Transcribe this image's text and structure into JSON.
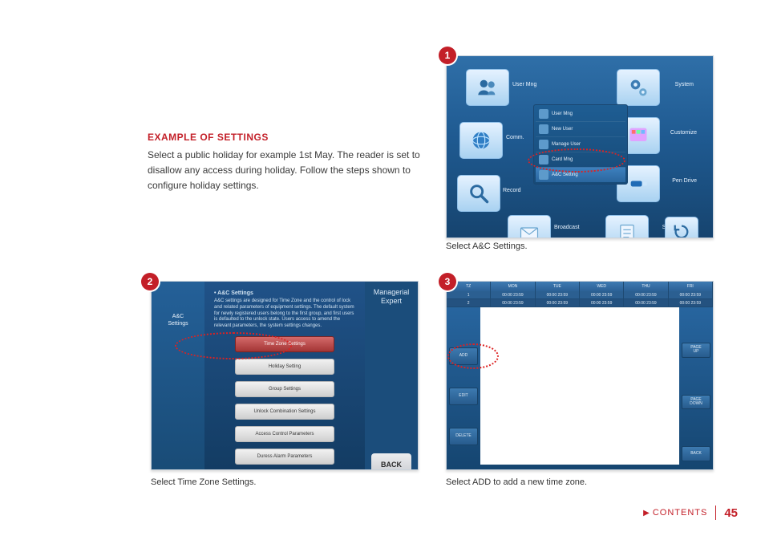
{
  "intro": {
    "heading": "EXAMPLE OF SETTINGS",
    "body": "Select a public holiday for example 1st May. The reader is set to disallow any access during holiday. Follow the steps shown to configure holiday settings."
  },
  "badges": {
    "n1": "1",
    "n2": "2",
    "n3": "3"
  },
  "captions": {
    "c1": "Select A&C Settings.",
    "c2": "Select Time Zone Settings.",
    "c3": "Select ADD to add a new time zone."
  },
  "footer": {
    "contents": "CONTENTS",
    "page": "45"
  },
  "screen1": {
    "tiles": {
      "user": "User Mng",
      "system": "System",
      "comm": "Comm.",
      "customize": "Customize",
      "record": "Record",
      "pdrive": "Pen Drive",
      "broadcast": "Broadcast",
      "sysinfo": "Sys Info"
    },
    "menu": [
      "User Mng",
      "New User",
      "Manage User",
      "Card Mng",
      "A&C Setting"
    ]
  },
  "screen2": {
    "sidebar_title": "A&C\nSettings",
    "right_title": "Managerial\nExpert",
    "back": "BACK",
    "desc_title": "• A&C Settings",
    "desc_body": "A&C settings are designed for Time Zone and the control of lock and related parameters of equipment settings. The default system for newly registered users belong to the first group, and first users is defaulted to the unlock state. Users access to amend the relevant parameters, the system settings changes.",
    "buttons": [
      "Time Zone Settings",
      "Holiday Setting",
      "Group Settings",
      "Unlock Combination Settings",
      "Access Control Parameters",
      "Duress Alarm Parameters"
    ]
  },
  "screen3": {
    "header": [
      "TZ",
      "MON",
      "TUE",
      "WED",
      "THU",
      "FRI"
    ],
    "row1": [
      "1",
      "00:00 23:59",
      "00:00 23:59",
      "00:00 23:59",
      "00:00 23:59",
      "00:00 23:59"
    ],
    "row2": [
      "2",
      "00:00 23:59",
      "00:00 23:59",
      "00:00 23:59",
      "00:00 23:59",
      "00:00 23:59"
    ],
    "left_buttons": [
      "ADD",
      "EDIT",
      "DELETE"
    ],
    "right_buttons": [
      "PAGE\nUP",
      "PAGE\nDOWN",
      "BACK"
    ]
  }
}
